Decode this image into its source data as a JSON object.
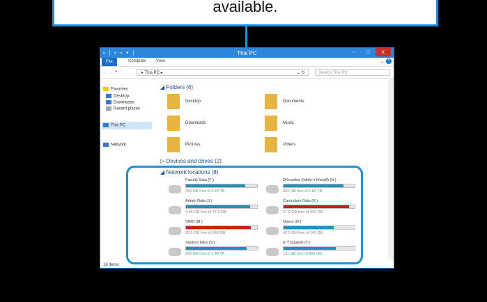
{
  "callout": {
    "text": "available."
  },
  "window": {
    "title": "This PC",
    "quick_access": "▪ | ▪ ▪ ▾ |",
    "controls": {
      "minimize": "–",
      "maximize": "□",
      "close": "x"
    }
  },
  "ribbon": {
    "tabs": [
      "File",
      "Computer",
      "View"
    ],
    "expand": "⌄",
    "help": "?"
  },
  "address": {
    "nav": "←  →  ▾  ↑",
    "path": "▸ This PC ▸",
    "refresh": "⌄  ↻",
    "search_placeholder": "Search This PC"
  },
  "nav": {
    "favorites": "Favorites",
    "desktop": "Desktop",
    "downloads": "Downloads",
    "recent": "Recent places",
    "this_pc": "This PC",
    "network": "Network"
  },
  "folders": {
    "heading": "◢ Folders (6)",
    "items": [
      "Desktop",
      "Documents",
      "Downloads",
      "Music",
      "Pictures",
      "Videos"
    ]
  },
  "devices_heading": "▷ Devices and drives (2)",
  "network": {
    "heading": "◢ Network locations (8)",
    "drives": [
      {
        "name": "Faculty Data (F:)",
        "free": "420 GB free of 2.44 TB",
        "fill": 0.83,
        "color": "#2a8fb4"
      },
      {
        "name": "DKnowles (\\\\dhfs-v-fs\\staff) (H:)",
        "free": "302 GB free of 1.89 TB",
        "fill": 0.84,
        "color": "#2a8fb4"
      },
      {
        "name": "Admin Data (J:)",
        "free": "4.86 GB free of 47.9 GB",
        "fill": 0.9,
        "color": "#2a8fb4"
      },
      {
        "name": "Curriculum Data (K:)",
        "free": "37.0 GB free of 449 GB",
        "fill": 0.92,
        "color": "#c81e1e"
      },
      {
        "name": "SIMS (M:)",
        "free": "22.6 GB free of 249 GB",
        "fill": 0.91,
        "color": "#c81e1e"
      },
      {
        "name": "Opera (O:)",
        "free": "42.5 GB free of 149 GB",
        "fill": 0.71,
        "color": "#2a8fb4"
      },
      {
        "name": "Student Files (S:)",
        "free": "365 GB free of 2.44 TB",
        "fill": 0.85,
        "color": "#2a8fb4"
      },
      {
        "name": "ICT Support (T:)",
        "free": "131 GB free of 499 GB",
        "fill": 0.74,
        "color": "#2a8fb4"
      }
    ]
  },
  "status": "16 items"
}
